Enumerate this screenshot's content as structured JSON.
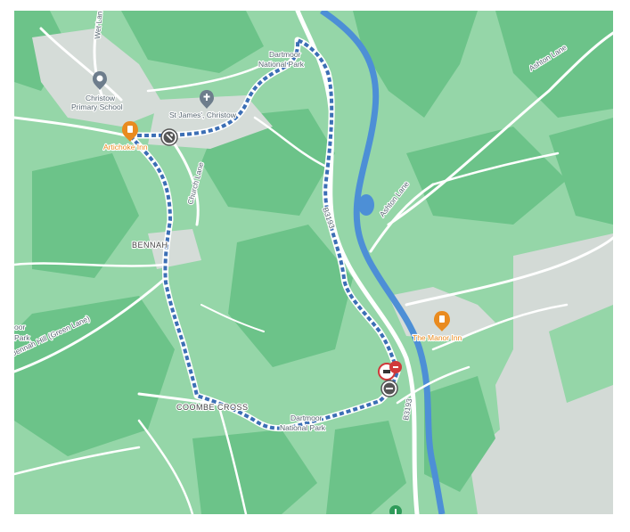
{
  "map": {
    "labels": {
      "wet_lane": "Wet Lane",
      "dartmoor_np_north_1": "Dartmoor",
      "dartmoor_np_north_2": "National Park",
      "ashton_lane_ne": "Ashton Lane",
      "christow_school_1": "Christow",
      "christow_school_2": "Primary School",
      "st_james": "St James', Christow",
      "ashton_lane_mid": "Ashton Lane",
      "church_lane": "Church Lane",
      "bennah": "BENNAH",
      "b3193_north": "B3193",
      "bennah_hill": "Bennah Hill (Green Lane)",
      "moor_1": "oor",
      "moor_2": "Park",
      "manor_inn": "The Manor Inn",
      "coombe_cross": "COOMBE CROSS",
      "dartmoor_np_south_1": "Dartmoor",
      "dartmoor_np_south_2": "National Park",
      "b3193_south": "B3193",
      "artichoke_inn": "Artichoke Inn"
    },
    "colors": {
      "land": "#95d6a8",
      "forest": "#6cc389",
      "river": "#4d8fd6",
      "route": "#3c6fb5",
      "urban": "#d5dcd8",
      "road": "#ffffff",
      "rock": "#d3dad6",
      "poi_food": "#e98b1f"
    }
  }
}
